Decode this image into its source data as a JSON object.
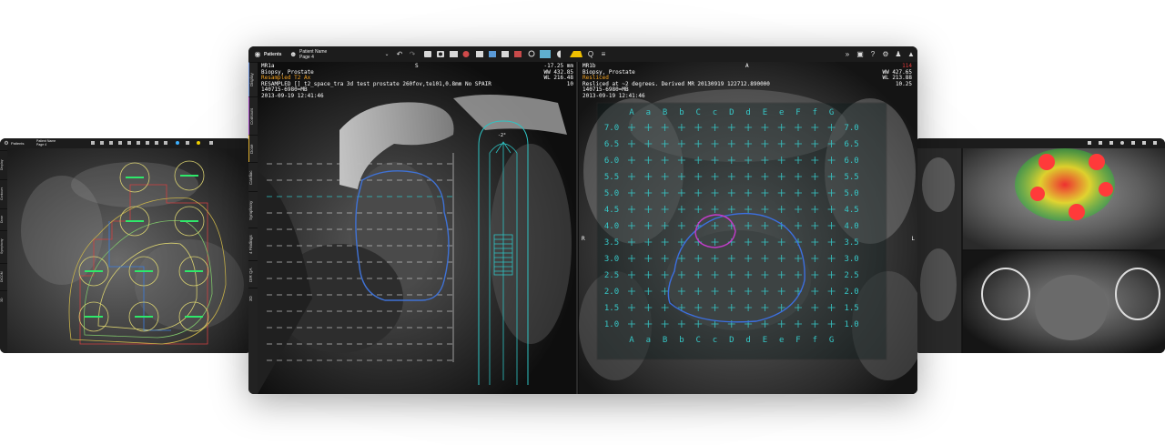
{
  "left_window": {
    "toolbar": {
      "patients_label": "Patients",
      "patient_name": "Patient Name",
      "page": "Page 4"
    },
    "tabs": [
      "Display",
      "Contours",
      "Dose",
      "Symphony",
      "DICOM",
      "3D"
    ]
  },
  "main_window": {
    "toolbar": {
      "patients_label": "Patients",
      "patient_name": "Patient Name",
      "page": "Page 4"
    },
    "tabs": [
      {
        "label": "Display",
        "color": "#6a8fd8"
      },
      {
        "label": "Contours",
        "color": "#a040c0"
      },
      {
        "label": "Dose",
        "color": "#e0b030"
      },
      {
        "label": "Cardiac",
        "color": "#666666"
      },
      {
        "label": "Symphony",
        "color": "#666666"
      },
      {
        "label": "4 Findings",
        "color": "#666666"
      },
      {
        "label": "DIR QA",
        "color": "#666666"
      },
      {
        "label": "3D",
        "color": "#666666"
      }
    ],
    "left_viewport": {
      "orientation_top": "S",
      "info_lines": [
        "MR1a",
        "Biopsy, Prostate",
        "Resampled T2 Ax",
        "RESAMPLED [] t2_space_tra 3d test prostate 260fov,te101,0.8mm No SPAIR",
        "140715-6980=MB",
        "2013-09-19 12:41:46"
      ],
      "info_right": [
        "-17.25 mm",
        "WW 432.85",
        "WL 216.48",
        "10"
      ],
      "needle_angle": "-2°",
      "colors": {
        "accent": "#2ec4c4",
        "contour": "#3f72d6"
      }
    },
    "right_viewport": {
      "orientation_top": "A",
      "orientation_left": "R",
      "orientation_right": "L",
      "info_lines": [
        "MR1b",
        "Biopsy, Prostate",
        "Resliced",
        "Resliced at ~2 degrees. Derived MR 20130919 122712.890000",
        "140715-6980=MB",
        "2013-09-19 12:41:46"
      ],
      "info_right": [
        "114",
        "WW 427.65",
        "WL 213.88",
        "10.25"
      ],
      "grid": {
        "columns": [
          "A",
          "a",
          "B",
          "b",
          "C",
          "c",
          "D",
          "d",
          "E",
          "e",
          "F",
          "f",
          "G"
        ],
        "rows": [
          "7.0",
          "6.5",
          "6.0",
          "5.5",
          "5.0",
          "4.5",
          "4.0",
          "3.5",
          "3.0",
          "2.5",
          "2.0",
          "1.5",
          "1.0"
        ],
        "color": "#36c7c7"
      },
      "colors": {
        "prostate": "#3c6fe0",
        "lesion": "#c33cc9"
      }
    }
  },
  "right_window": {
    "toolbar": {}
  }
}
